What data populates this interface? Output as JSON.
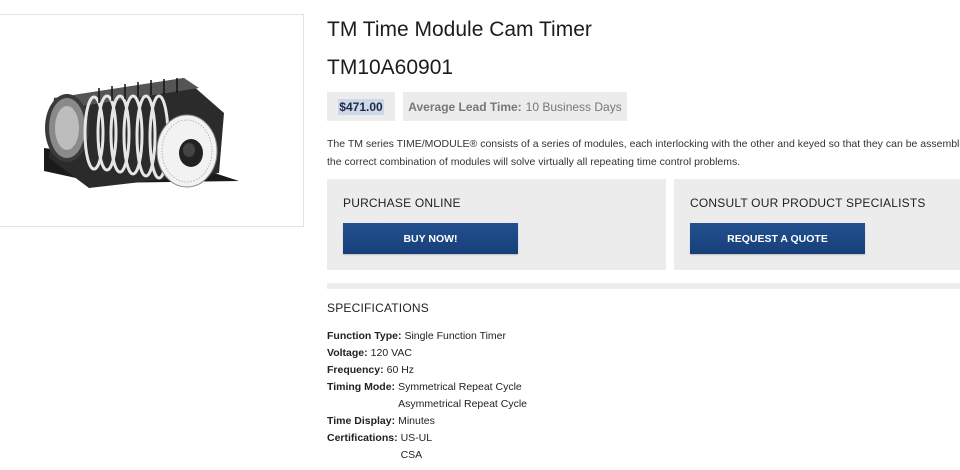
{
  "product": {
    "title": "TM Time Module Cam Timer",
    "sku": "TM10A60901",
    "price": "$471.00",
    "lead_time_label": "Average Lead Time:",
    "lead_time_value": "10 Business Days",
    "description_line1": "The TM series TIME/MODULE® consists of a series of modules, each interlocking with the other and keyed so that they can be assembled only",
    "description_line2": "the correct combination of modules will solve virtually all repeating time control problems."
  },
  "purchase": {
    "title": "PURCHASE ONLINE",
    "button_label": "BUY NOW!"
  },
  "consult": {
    "title": "CONSULT OUR PRODUCT SPECIALISTS",
    "button_label": "REQUEST A QUOTE"
  },
  "specifications": {
    "title": "SPECIFICATIONS",
    "rows": [
      {
        "label": "Function Type:",
        "values": [
          "Single Function Timer"
        ]
      },
      {
        "label": "Voltage:",
        "values": [
          "120 VAC"
        ]
      },
      {
        "label": "Frequency:",
        "values": [
          "60 Hz"
        ]
      },
      {
        "label": "Timing Mode:",
        "values": [
          "Symmetrical Repeat Cycle",
          "Asymmetrical Repeat Cycle"
        ]
      },
      {
        "label": "Time Display:",
        "values": [
          "Minutes"
        ]
      },
      {
        "label": "Certifications:",
        "values": [
          "US-UL",
          "CSA"
        ]
      }
    ]
  },
  "colors": {
    "button": "#1c4788",
    "panel": "#ececec",
    "price_highlight": "#cfd8ea"
  }
}
